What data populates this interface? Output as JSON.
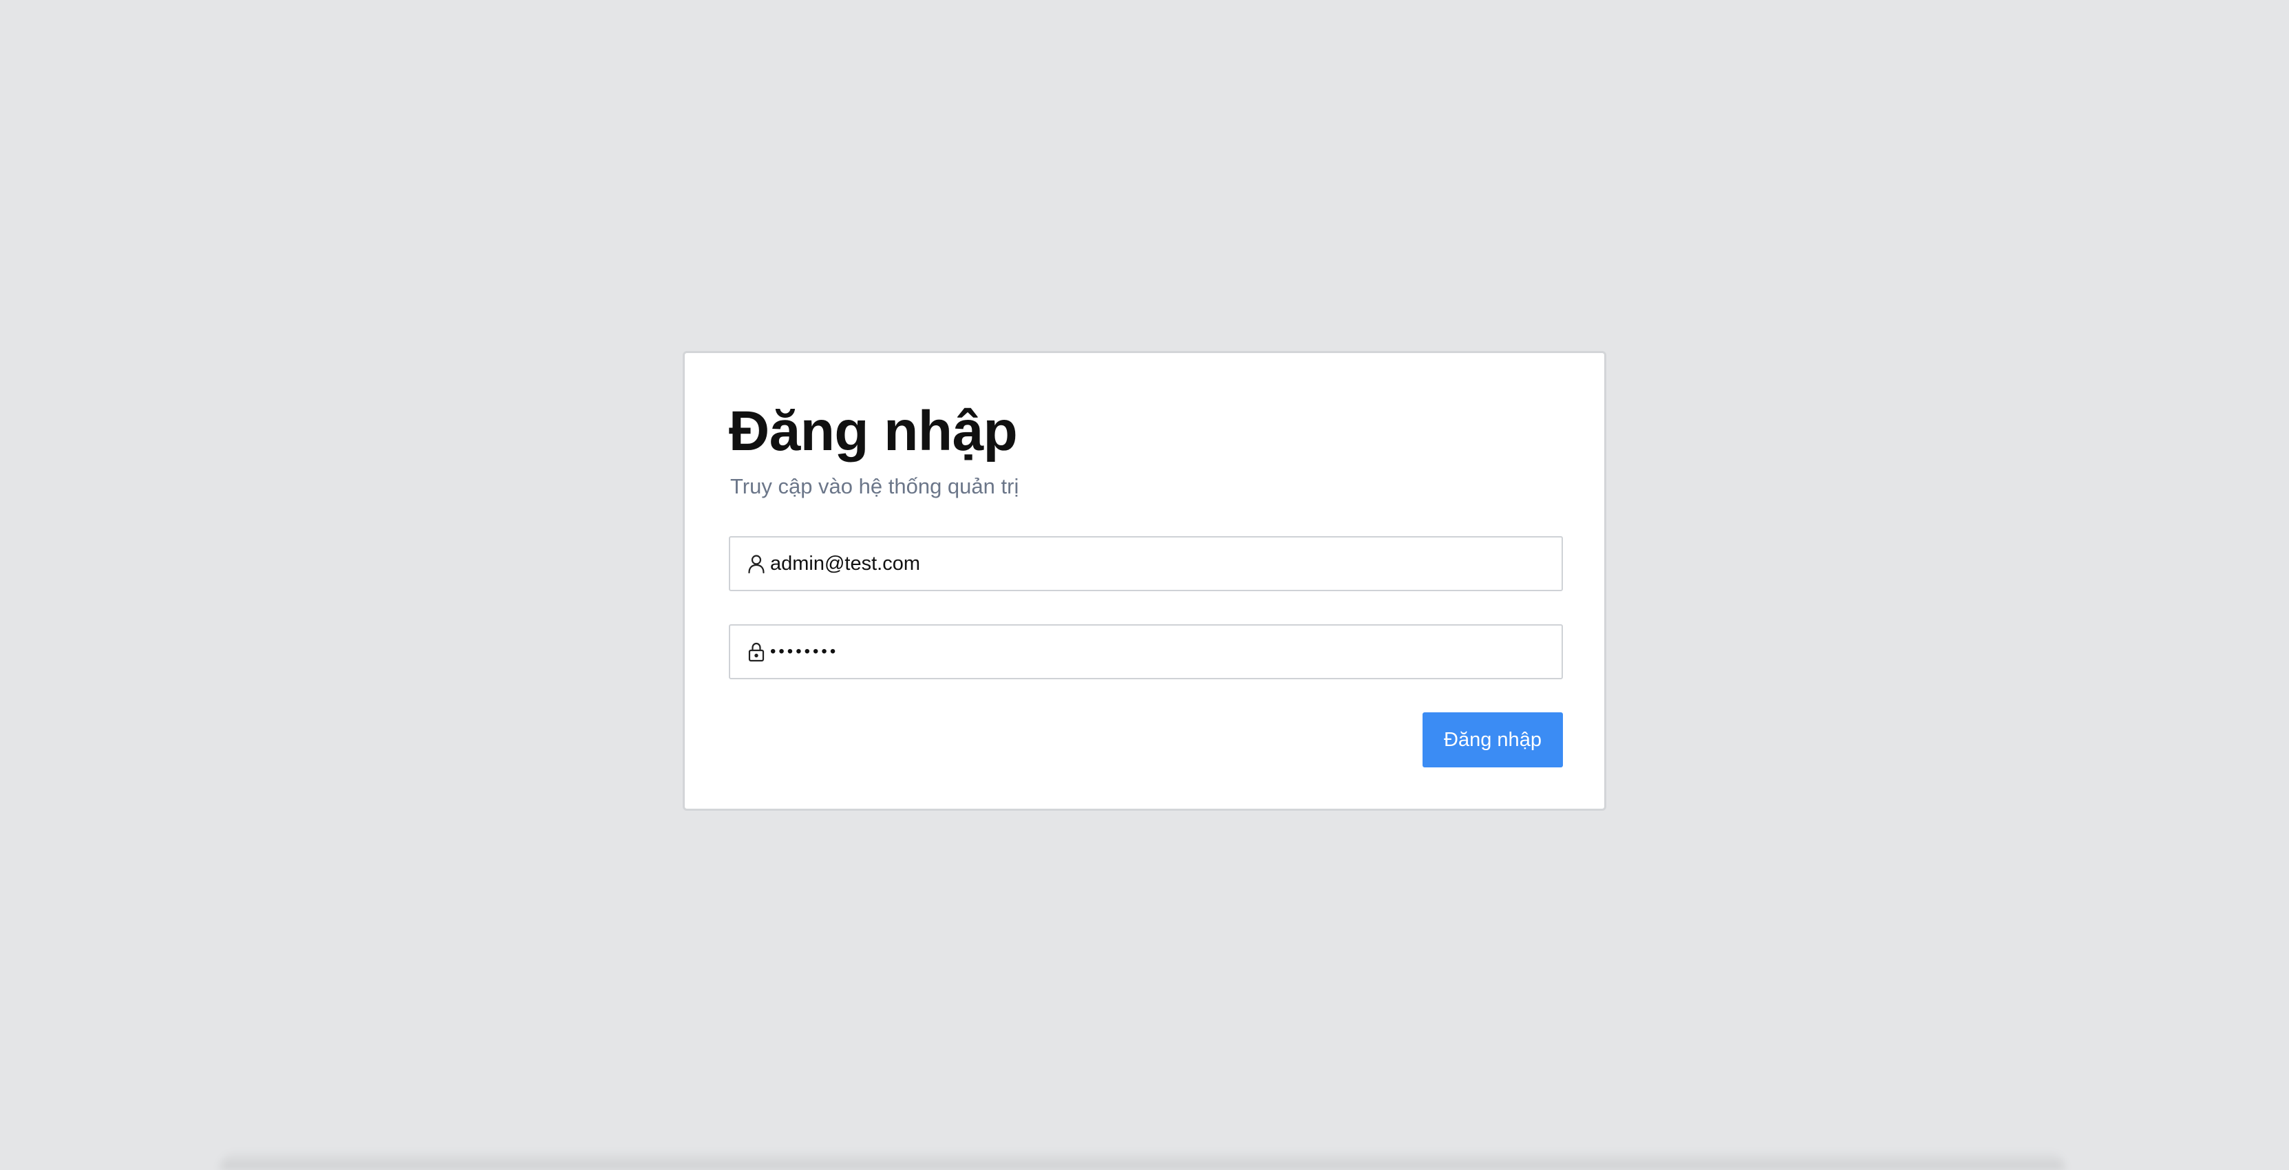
{
  "login": {
    "title": "Đăng nhập",
    "subtitle": "Truy cập vào hệ thống quản trị",
    "email": {
      "value": "admin@test.com",
      "icon": "user-icon"
    },
    "password": {
      "value": "••••••••",
      "icon": "lock-icon"
    },
    "submit_label": "Đăng nhập"
  },
  "colors": {
    "background": "#e4e5e7",
    "card": "#ffffff",
    "accent": "#3b8cf4",
    "subtitle": "#6b7689"
  }
}
